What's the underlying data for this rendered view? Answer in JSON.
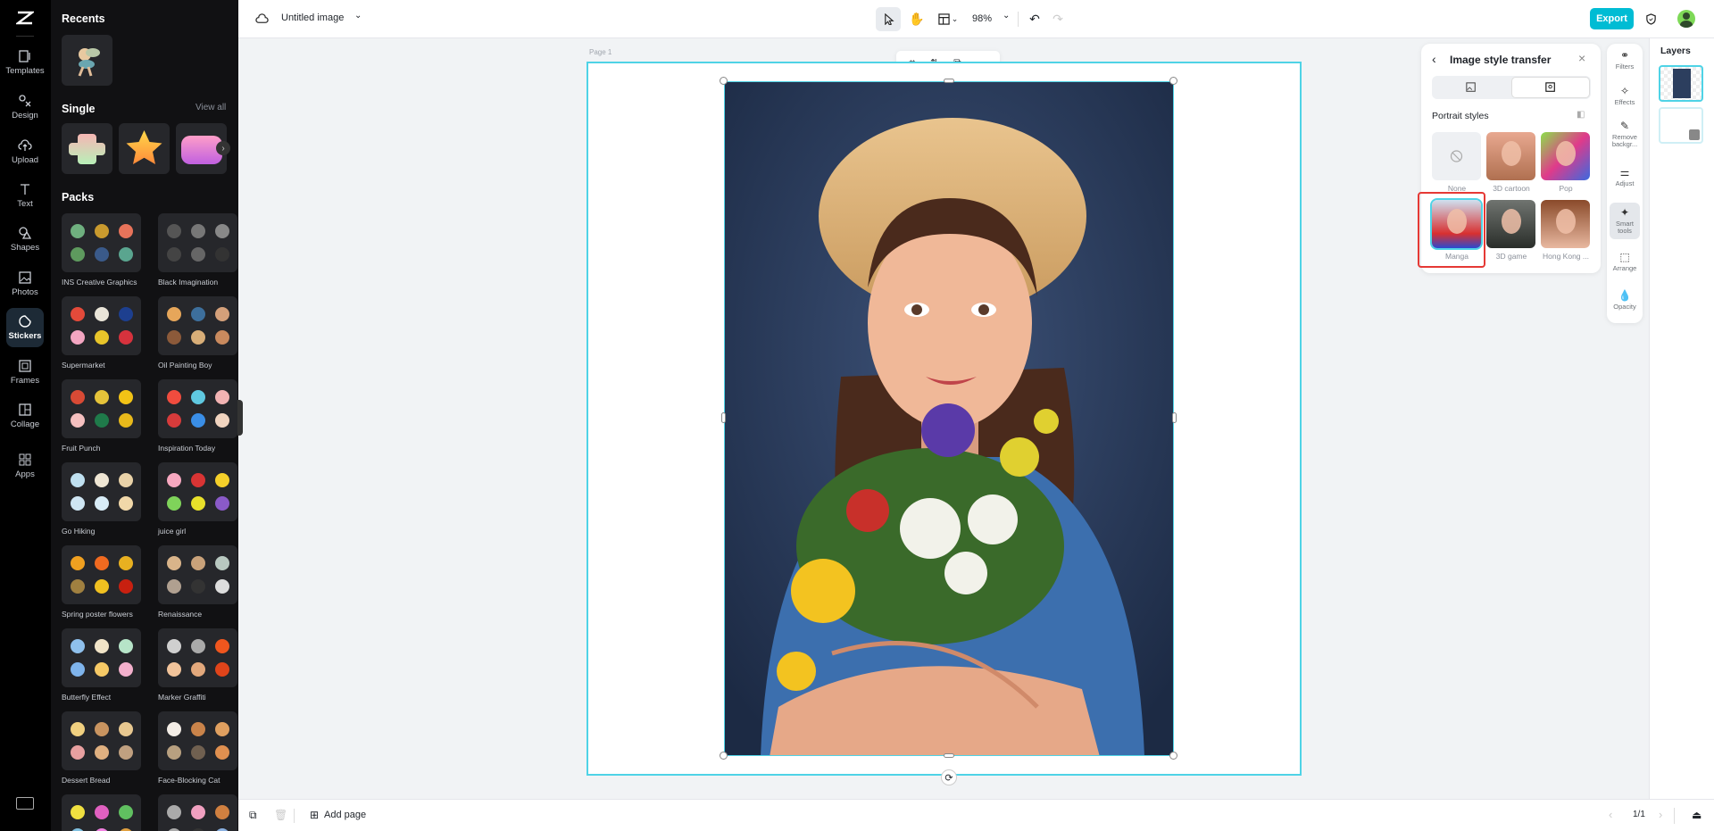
{
  "rail": {
    "items": [
      {
        "label": "Templates",
        "icon": "templates-icon"
      },
      {
        "label": "Design",
        "icon": "design-icon"
      },
      {
        "label": "Upload",
        "icon": "upload-icon"
      },
      {
        "label": "Text",
        "icon": "text-icon"
      },
      {
        "label": "Shapes",
        "icon": "shapes-icon"
      },
      {
        "label": "Photos",
        "icon": "photos-icon"
      },
      {
        "label": "Stickers",
        "icon": "stickers-icon",
        "active": true
      },
      {
        "label": "Frames",
        "icon": "frames-icon"
      },
      {
        "label": "Collage",
        "icon": "collage-icon"
      },
      {
        "label": "Apps",
        "icon": "apps-icon"
      }
    ]
  },
  "panel": {
    "recents_title": "Recents",
    "single_title": "Single",
    "view_all": "View all",
    "packs_title": "Packs",
    "packs": [
      {
        "name": "INS Creative Graphics",
        "colors": [
          "#6fb07f",
          "#c99a2e",
          "#e7735a",
          "#5e9a5e",
          "#3a5a8a",
          "#5aa58f"
        ]
      },
      {
        "name": "Black Imagination",
        "colors": [
          "#555",
          "#777",
          "#888",
          "#444",
          "#666",
          "#333"
        ]
      },
      {
        "name": "Supermarket",
        "colors": [
          "#e34a3a",
          "#e9e4d8",
          "#1d3f8f",
          "#f4a6c2",
          "#e8c52a",
          "#d7323d"
        ]
      },
      {
        "name": "Oil Painting Boy",
        "colors": [
          "#e6a65a",
          "#3d6f9c",
          "#d4a07a",
          "#8c5a3a",
          "#d8ae78",
          "#c98a5e"
        ]
      },
      {
        "name": "Fruit Punch",
        "colors": [
          "#d84a35",
          "#e5c33a",
          "#f2c316",
          "#f5c0c0",
          "#1f7a4a",
          "#e8b91b"
        ]
      },
      {
        "name": "Inspiration Today",
        "colors": [
          "#f04c3e",
          "#5fc8e0",
          "#f2b3b3",
          "#d63b3b",
          "#3a8ee6",
          "#f1d4c0"
        ]
      },
      {
        "name": "Go Hiking",
        "colors": [
          "#bfe0f0",
          "#efe6d4",
          "#e9d2a8",
          "#cfe6f3",
          "#d8ecf7",
          "#f1d8a9"
        ]
      },
      {
        "name": "juice girl",
        "colors": [
          "#f7a8c0",
          "#d93434",
          "#f5d02a",
          "#7fd35a",
          "#e8e02a",
          "#8a5ac8"
        ]
      },
      {
        "name": "Spring poster flowers",
        "colors": [
          "#f0a020",
          "#f06a20",
          "#e8b020",
          "#a08040",
          "#f0c020",
          "#c82010"
        ]
      },
      {
        "name": "Renaissance",
        "colors": [
          "#d9b48a",
          "#c9a27a",
          "#b8c8c0",
          "#b0a090",
          "#333",
          "#ddd"
        ]
      },
      {
        "name": "Butterfly Effect",
        "colors": [
          "#8fc0ec",
          "#f1e4c8",
          "#b6e4c8",
          "#7fb4ec",
          "#f6c966",
          "#f3b0cc"
        ]
      },
      {
        "name": "Marker Graffiti",
        "colors": [
          "#cfcfcf",
          "#aaaaaa",
          "#f0561e",
          "#f1c39a",
          "#e2a87c",
          "#e0441a"
        ]
      },
      {
        "name": "Dessert Bread",
        "colors": [
          "#f0d080",
          "#c99460",
          "#e8c890",
          "#e8a0a0",
          "#e0b080",
          "#c0a080"
        ]
      },
      {
        "name": "Face-Blocking Cat",
        "colors": [
          "#f3ede6",
          "#c9834a",
          "#e0a060",
          "#b8a080",
          "#706050",
          "#e09050"
        ]
      },
      {
        "name": "",
        "colors": [
          "#f0e040",
          "#e060c0",
          "#60c060",
          "#80c0e0",
          "#f080e0",
          "#e0a040"
        ]
      },
      {
        "name": "",
        "colors": [
          "#aaa",
          "#f0a0c0",
          "#d08040",
          "#aaa",
          "#333",
          "#8ab0e0"
        ]
      }
    ]
  },
  "topbar": {
    "title": "Untitled image",
    "zoom": "98%",
    "export": "Export"
  },
  "canvas": {
    "page_label": "Page 1"
  },
  "style_panel": {
    "title": "Image style transfer",
    "section": "Portrait styles",
    "styles": [
      {
        "label": "None"
      },
      {
        "label": "3D cartoon"
      },
      {
        "label": "Pop"
      },
      {
        "label": "Manga",
        "selected": true
      },
      {
        "label": "3D game"
      },
      {
        "label": "Hong Kong ..."
      }
    ]
  },
  "tools": [
    {
      "label": "Filters"
    },
    {
      "label": "Effects"
    },
    {
      "label": "Remove backgr..."
    },
    {
      "label": "Adjust"
    },
    {
      "label": "Smart tools",
      "active": true
    },
    {
      "label": "Arrange"
    },
    {
      "label": "Opacity"
    }
  ],
  "layers": {
    "title": "Layers"
  },
  "bottombar": {
    "add_page": "Add page",
    "page_count": "1/1"
  },
  "colors": {
    "accent": "#00bcd4",
    "selection": "#4fd3e6",
    "highlight": "#e53935"
  }
}
